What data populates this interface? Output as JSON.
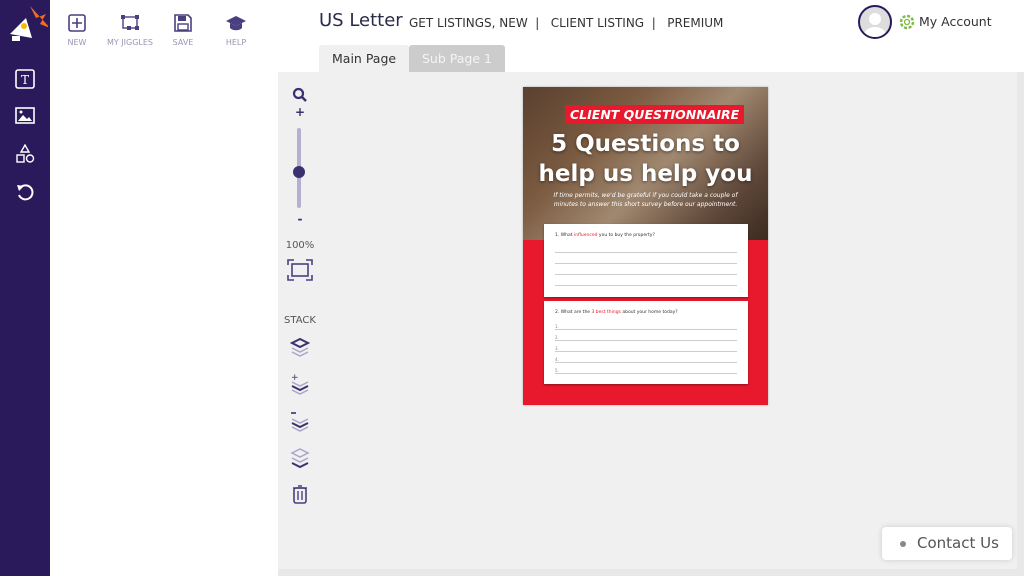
{
  "toolbar": {
    "new": "NEW",
    "my_jiggles": "MY JIGGLES",
    "save": "SAVE",
    "help": "HELP"
  },
  "header": {
    "title": "US Letter",
    "links": "GET LISTINGS, NEW  |   CLIENT LISTING  |   PREMIUM",
    "account": "My Account"
  },
  "tabs": [
    {
      "label": "Main Page",
      "active": true
    },
    {
      "label": "Sub Page 1",
      "active": false
    }
  ],
  "zoom": {
    "plus": "+",
    "minus": "-",
    "level": "100%",
    "slider_percent": 50
  },
  "stack": {
    "label": "STACK"
  },
  "document": {
    "badge": "CLIENT QUESTIONNAIRE",
    "headline1": "5 Questions to",
    "headline2": "help us help you",
    "intro": "If time permits, we'd be grateful if you could take a couple of minutes to answer this short survey before our appointment.",
    "q1": {
      "pre": "1. What ",
      "hl": "influenced",
      "post": " you to buy the property?"
    },
    "q2": {
      "pre": "2. What are the ",
      "hl": "3 best things",
      "post": " about your home today?"
    },
    "nums": [
      "1.",
      "2.",
      "3.",
      "4.",
      "5."
    ]
  },
  "contact": "Contact Us",
  "colors": {
    "sidebar": "#2a1a5c",
    "accent_red": "#e8192c",
    "gear": "#7dbb42"
  }
}
